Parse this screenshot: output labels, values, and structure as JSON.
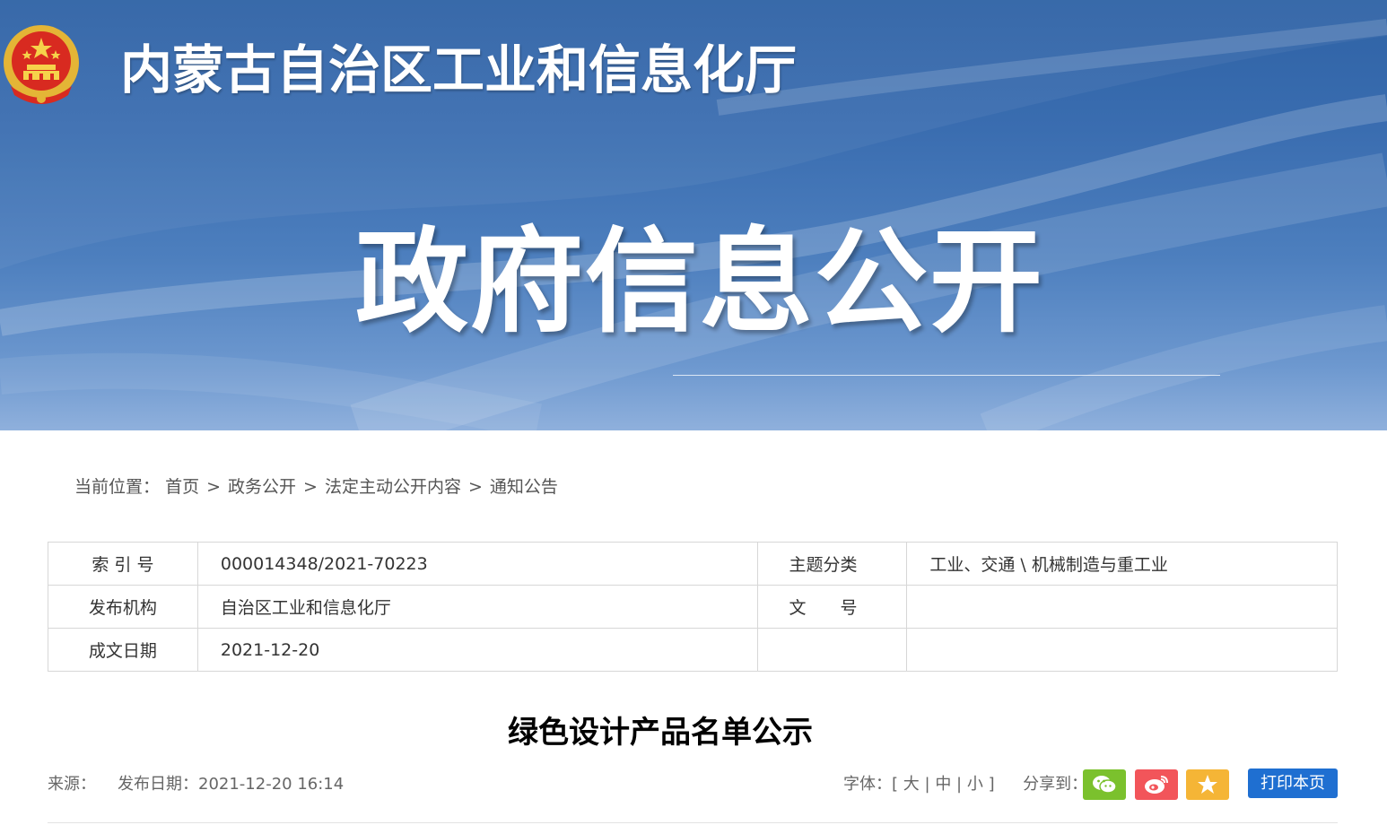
{
  "header": {
    "site_title": "内蒙古自治区工业和信息化厅",
    "banner_title": "政府信息公开",
    "emblem_icon": "national-emblem-icon"
  },
  "breadcrumb": {
    "label": "当前位置：",
    "items": [
      "首页",
      "政务公开",
      "法定主动公开内容",
      "通知公告"
    ],
    "separator": ">"
  },
  "meta": {
    "index_label": "索 引 号",
    "index_value": "000014348/2021-70223",
    "topic_label": "主题分类",
    "topic_value": "工业、交通 \\ 机械制造与重工业",
    "publisher_label": "发布机构",
    "publisher_value": "自治区工业和信息化厅",
    "docno_label": "文　　号",
    "docno_value": "",
    "date_label": "成文日期",
    "date_value": "2021-12-20"
  },
  "article": {
    "title": "绿色设计产品名单公示",
    "source_label": "来源：",
    "source_value": "",
    "publish_label": "发布日期：",
    "publish_value": "2021-12-20 16:14"
  },
  "tools": {
    "font_label": "字体：",
    "font_open": "[",
    "font_large": "大",
    "font_medium": "中",
    "font_small": "小",
    "font_close": "]",
    "font_sep": "|",
    "share_label": "分享到：",
    "share_icons": [
      "wechat-icon",
      "weibo-icon",
      "favorite-star-icon"
    ],
    "print_label": "打印本页"
  },
  "colors": {
    "banner_blue": "#3a6db0",
    "print_button": "#1f6fd1",
    "wechat": "#7bc12d",
    "weibo": "#f2555a",
    "favorite": "#f5b536"
  }
}
